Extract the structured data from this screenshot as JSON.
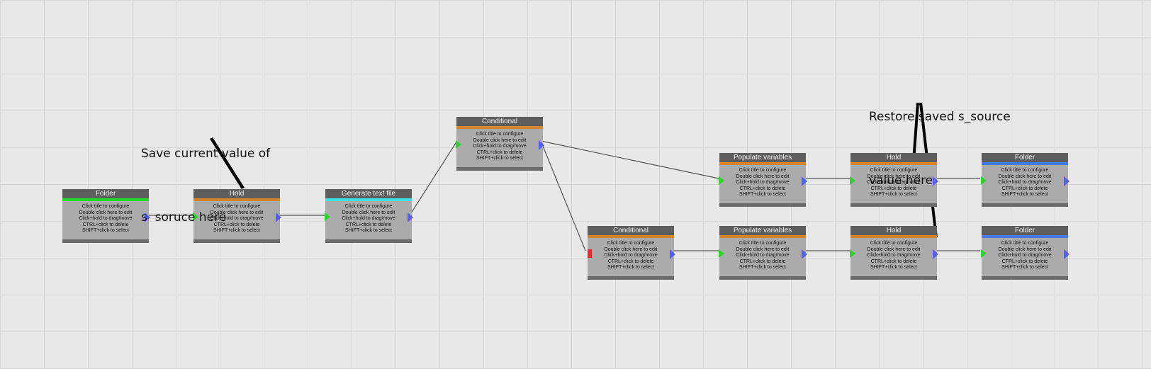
{
  "help_lines": [
    "Click title to configure",
    "Double click here to edit",
    "Click+hold to drag/move",
    "CTRL+click to delete",
    "SHIFT+click to select"
  ],
  "nodes": [
    {
      "id": "folder-1",
      "title": "Folder",
      "accent": "#27d827"
    },
    {
      "id": "hold-1",
      "title": "Hold",
      "accent": "#d6852f"
    },
    {
      "id": "generate-text-file",
      "title": "Generate text file",
      "accent": "#3ee0ee"
    },
    {
      "id": "conditional-1",
      "title": "Conditional",
      "accent": "#d6852f"
    },
    {
      "id": "conditional-2",
      "title": "Conditional",
      "accent": "#d6852f"
    },
    {
      "id": "populate-variables-1",
      "title": "Populate variables",
      "accent": "#d6852f"
    },
    {
      "id": "populate-variables-2",
      "title": "Populate variables",
      "accent": "#d6852f"
    },
    {
      "id": "hold-2",
      "title": "Hold",
      "accent": "#d6852f"
    },
    {
      "id": "hold-3",
      "title": "Hold",
      "accent": "#d6852f"
    },
    {
      "id": "folder-2",
      "title": "Folder",
      "accent": "#4a78e6"
    },
    {
      "id": "folder-3",
      "title": "Folder",
      "accent": "#4a78e6"
    }
  ],
  "annotations": {
    "save_note_line1": "Save current value of",
    "save_note_line2": "s  soruce here",
    "restore_note_line1": "Restore saved s_source",
    "restore_note_line2": "value here"
  },
  "colors": {
    "input_port": "#2fd22f",
    "input_port_error": "#e22b2b",
    "output_port": "#5b5bf2",
    "title_bar": "#5e5e5e",
    "node_body": "#ababab"
  }
}
